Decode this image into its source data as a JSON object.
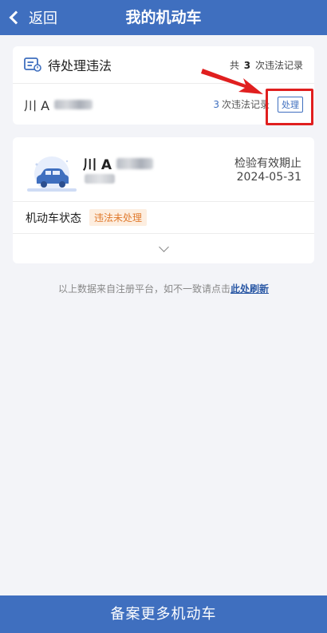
{
  "header": {
    "back_label": "返回",
    "title": "我的机动车"
  },
  "pending": {
    "title": "待处理违法",
    "total_prefix": "共",
    "total_count": "3",
    "total_suffix": "次违法记录",
    "vehicle": {
      "plate_prefix": "川 A",
      "count": "3",
      "count_suffix": "次违法记录",
      "handle_label": "处理"
    }
  },
  "car": {
    "plate_prefix": "川 A",
    "inspection_label": "检验有效期止",
    "inspection_date": "2024-05-31",
    "status_label": "机动车状态",
    "status_badge": "违法未处理"
  },
  "notice": {
    "text": "以上数据来自注册平台，如不一致请点击",
    "link": "此处刷新"
  },
  "footer": {
    "button_label": "备案更多机动车"
  },
  "colors": {
    "primary": "#3f6fbf",
    "highlight": "#e01f1f",
    "badge": "#e07b2f"
  }
}
